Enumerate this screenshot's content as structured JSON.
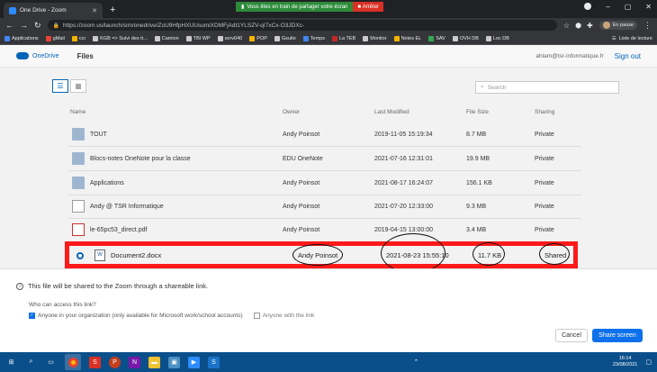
{
  "browser": {
    "tab_title": "One Drive - Zoom",
    "new_tab": "+",
    "url": "https://zoom.us/launch/sim/onedrive/ZoU9HfpHXUUsumiXDMFjAdt1YLSZV-qI7xCx-O3JDXc-",
    "share_banner": "Vous êtes en train de partager votre écran",
    "share_stop": "Arrêter",
    "profile_label": "En pause",
    "bookmarks": [
      "Applications",
      "gMail",
      "ccr",
      "KGB => Suivi des tr...",
      "Camion",
      "TBI WP",
      "serv040",
      "POP",
      "Gsuite",
      "Temps",
      "La TEB",
      "Monitor",
      "Notes EL",
      "SAV",
      "OVH DB",
      "Loc DB"
    ],
    "reading_list": "Liste de lecture"
  },
  "onedrive": {
    "app_name": "OneDrive",
    "section": "Files",
    "user_email": "ahlam@tsr-informatique.fr",
    "sign_out": "Sign out",
    "search_placeholder": "Search",
    "columns": [
      "Name",
      "Owner",
      "Last Modified",
      "File Size",
      "Sharing"
    ],
    "files": [
      {
        "name": "TOUT",
        "owner": "Andy Poinsot",
        "modified": "2019-11-05 15:19:34",
        "size": "8.7 MB",
        "sharing": "Private",
        "kind": "folder"
      },
      {
        "name": "Blocs-notes OneNote pour la classe",
        "owner": "EDU OneNote",
        "modified": "2021-07-16 12:31:01",
        "size": "19.9 MB",
        "sharing": "Private",
        "kind": "folder"
      },
      {
        "name": "Applications",
        "owner": "Andy Poinsot",
        "modified": "2021-08-17 16:24:07",
        "size": "156.1 KB",
        "sharing": "Private",
        "kind": "folder"
      },
      {
        "name": "Andy @ TSR Informatique",
        "owner": "Andy Poinsot",
        "modified": "2021-07-20 12:33:00",
        "size": "9.3 MB",
        "sharing": "Private",
        "kind": "doc"
      },
      {
        "name": "le-65pc53_direct.pdf",
        "owner": "Andy Poinsot",
        "modified": "2019-04-15 13:00:00",
        "size": "3.4 MB",
        "sharing": "Private",
        "kind": "pdf"
      }
    ],
    "selected": {
      "name": "Document2.docx",
      "owner": "Andy Poinsot",
      "modified": "2021-08-23 15:55:10",
      "size": "11.7 KB",
      "sharing": "Shared",
      "icon_letter": "W"
    }
  },
  "dialog": {
    "info_text": "This file will be shared to the Zoom through a shareable link.",
    "question": "Who can access this link?",
    "option_org": "Anyone in your organization (only available for Microsoft work/school accounts)",
    "option_anyone": "Anyone with the link",
    "cancel": "Cancel",
    "share": "Share screen"
  },
  "taskbar": {
    "time": "16:14",
    "date": "23/08/2021"
  }
}
